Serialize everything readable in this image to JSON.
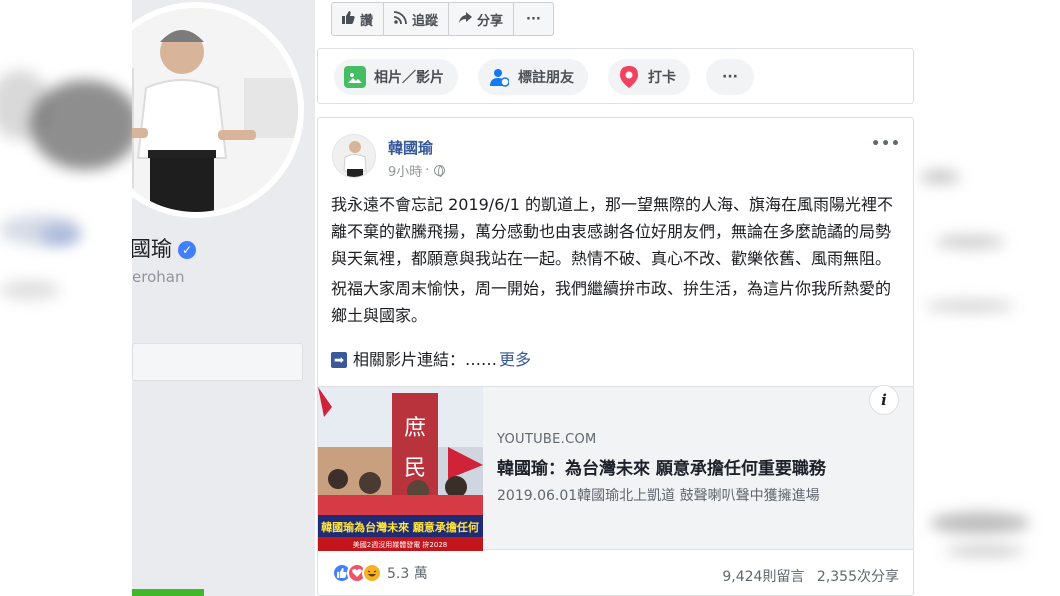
{
  "profile": {
    "name": "瑜",
    "name_partial": "國瑜",
    "handle": "erohan"
  },
  "actions": {
    "like_label": "讚",
    "follow_label": "追蹤",
    "share_label": "分享",
    "more_label": "···"
  },
  "composer": {
    "photo_label": "相片／影片",
    "tag_label": "標註朋友",
    "checkin_label": "打卡",
    "more_label": "···"
  },
  "post": {
    "author": "韓國瑜",
    "time": "9小時",
    "time_separator": "·",
    "more_label": "•••",
    "paragraph_1": "我永遠不會忘記 2019/6/1 的凱道上，那一望無際的人海、旗海在風雨陽光裡不離不棄的歡騰飛揚，萬分感動也由衷感謝各位好朋友們，無論在多麼詭譎的局勢與天氣裡，都願意與我站在一起。熱情不破、真心不改、歡樂依舊、風雨無阻。",
    "paragraph_2": "祝福大家周末愉快，周一開始，我們繼續拚市政、拚生活，為這片你我所熱愛的鄉土與國家。",
    "related_label": "相關影片連結：……",
    "see_more": "更多"
  },
  "link_preview": {
    "domain": "YOUTUBE.COM",
    "title": "韓國瑜：為台灣未來 願意承擔任何重要職務",
    "description": "2019.06.01韓國瑜北上凱道 鼓聲喇叭聲中獲擁進場",
    "thumb_banner": "韓國瑜為台灣未來 願意承擔任何",
    "thumb_ticker": "美國2週沒用媒體發電 拚2028",
    "thumb_flag_text_1": "庶",
    "thumb_flag_text_2": "民",
    "info_label": "i"
  },
  "engagement": {
    "reaction_count": "5.3 萬",
    "comments": "9,424則留言",
    "shares": "2,355次分享"
  },
  "colors": {
    "link_blue": "#365899",
    "facebook_blue": "#4080ff",
    "love_red": "#f25268",
    "haha_yellow": "#f7b125",
    "checkin_red": "#f3425f",
    "green_accent": "#42b72a"
  },
  "icons": {
    "like": "thumbs-up-icon",
    "follow": "rss-icon",
    "share": "share-arrow-icon",
    "photo": "photo-icon",
    "tag": "tag-person-icon",
    "checkin": "location-pin-icon",
    "globe": "globe-icon",
    "verified": "verified-check-icon",
    "related": "arrow-right-box-icon",
    "info": "info-icon"
  }
}
